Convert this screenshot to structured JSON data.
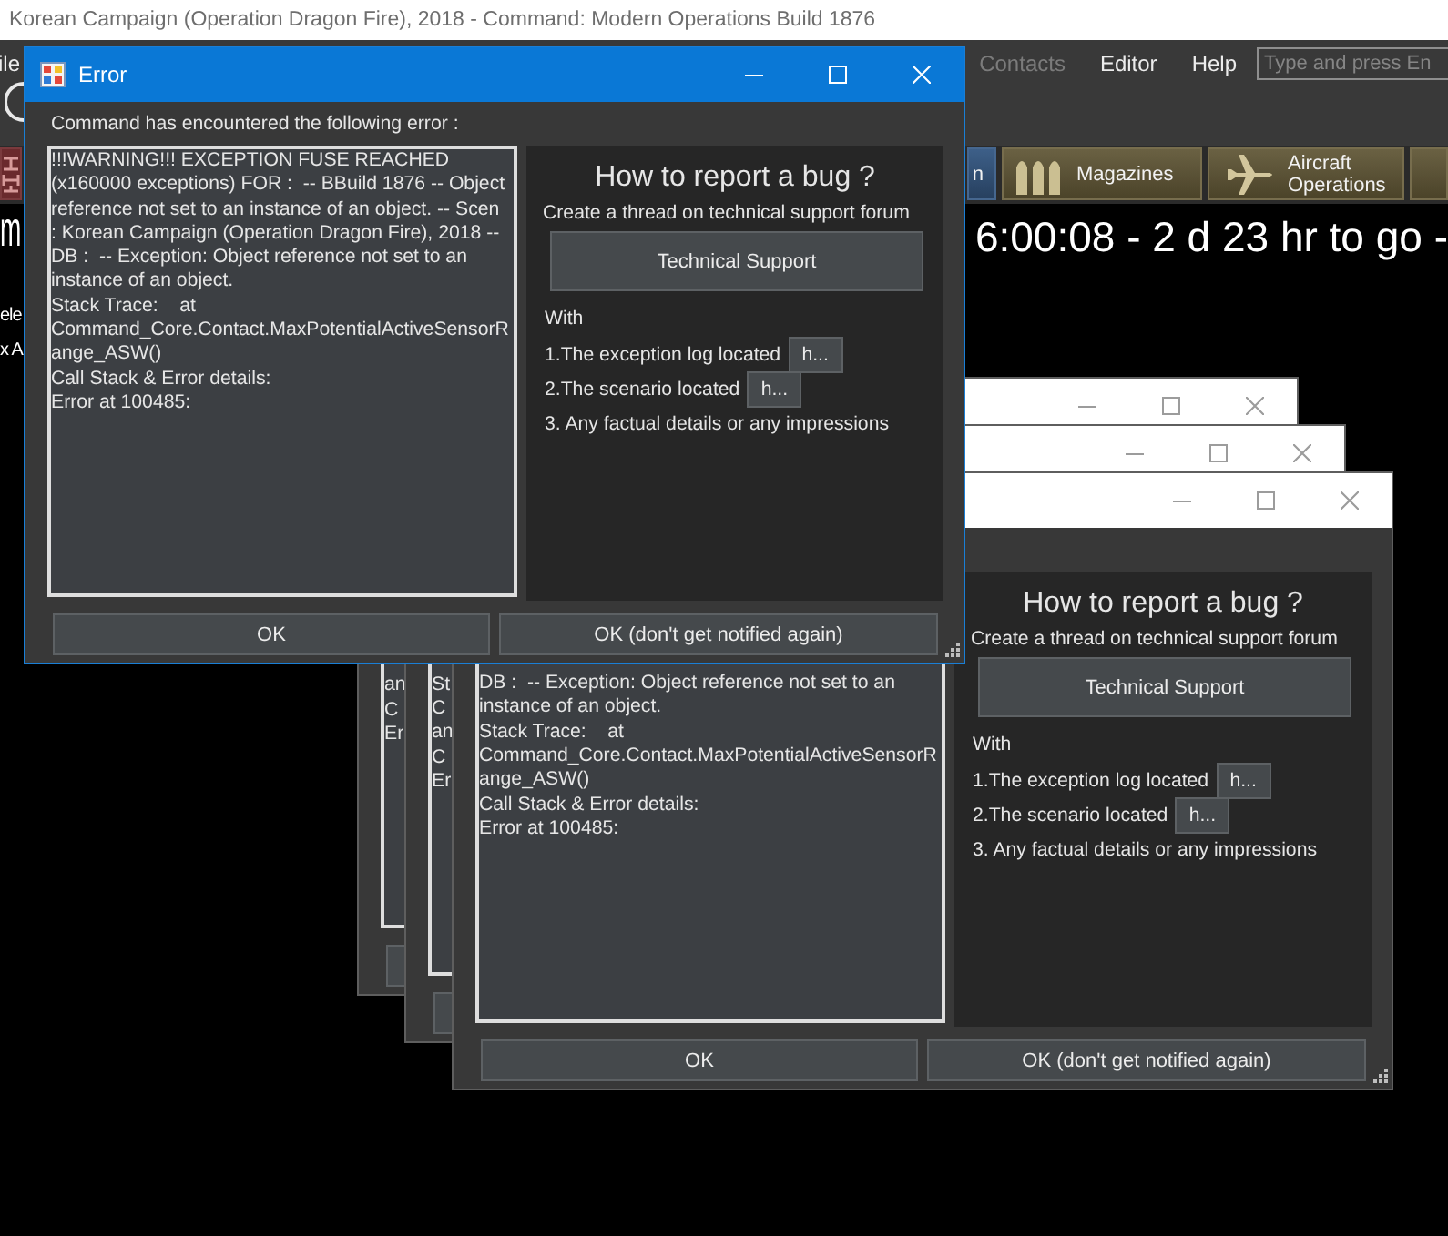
{
  "app": {
    "title": "Korean Campaign (Operation Dragon Fire), 2018 - Command: Modern Operations Build 1876",
    "menu": [
      {
        "label": "ile",
        "disabled": false
      },
      {
        "label": "Contacts",
        "disabled": true
      },
      {
        "label": "Editor",
        "disabled": false
      },
      {
        "label": "Help",
        "disabled": false
      }
    ],
    "search": {
      "placeholder": "Type and press En"
    },
    "tabs": [
      {
        "kind": "emblem",
        "selected": false
      },
      {
        "kind": "plain",
        "label": "n",
        "selected": true
      },
      {
        "kind": "magazines",
        "label": "Magazines",
        "selected": false
      },
      {
        "kind": "aircraft",
        "label": "Aircraft Operations",
        "selected": false
      },
      {
        "kind": "plain",
        "selected": false
      }
    ],
    "clock_row": {
      "heading": "m",
      "clock": "6:00:08 - 2 d 23 hr to go -"
    },
    "side_labels": [
      "ele",
      "x A"
    ]
  },
  "dialogs": [
    {
      "kind": "strip",
      "active": false,
      "message": [
        "an",
        "C",
        "Er"
      ]
    },
    {
      "kind": "strip",
      "active": false,
      "message": [
        "St",
        "C",
        "an",
        "C",
        "Er"
      ]
    },
    {
      "kind": "full",
      "active": false,
      "message": [
        "DB :  -- Exception: Object reference not set to an",
        "instance of an object.",
        "Stack Trace:    at",
        "Command_Core.Contact.MaxPotentialActiveSensorR",
        "ange_ASW()",
        "Call Stack & Error details:",
        "Error at 100485:"
      ],
      "help": {
        "heading": "How to report a bug ?",
        "intro": "Create a thread on technical support forum",
        "button": "Technical Support",
        "with": "With",
        "steps": [
          {
            "text": "1.The exception log located",
            "button": "h..."
          },
          {
            "text": "2.The scenario located",
            "button": "h..."
          },
          {
            "text": "3. Any factual details or any impressions"
          }
        ]
      },
      "buttons": [
        "OK",
        "OK (don't get notified again)"
      ]
    },
    {
      "kind": "full",
      "active": true,
      "title": "Error",
      "intro": "Command has encountered the following error :",
      "message": [
        "!!!WARNING!!! EXCEPTION FUSE REACHED",
        "(x160000 exceptions) FOR :  -- BBuild 1876 -- Object",
        "reference not set to an instance of an object. -- Scen",
        ": Korean Campaign (Operation Dragon Fire), 2018 --",
        "DB :  -- Exception: Object reference not set to an",
        "instance of an object.",
        "Stack Trace:    at",
        "Command_Core.Contact.MaxPotentialActiveSensorR",
        "ange_ASW()",
        "Call Stack & Error details:",
        "Error at 100485:"
      ],
      "help": {
        "heading": "How to report a bug ?",
        "intro": "Create a thread on technical support forum",
        "button": "Technical Support",
        "with": "With",
        "steps": [
          {
            "text": "1.The exception log located",
            "button": "h..."
          },
          {
            "text": "2.The scenario located",
            "button": "h..."
          },
          {
            "text": "3. Any factual details or any impressions"
          }
        ]
      },
      "buttons": [
        "OK",
        "OK (don't get notified again)"
      ]
    }
  ]
}
